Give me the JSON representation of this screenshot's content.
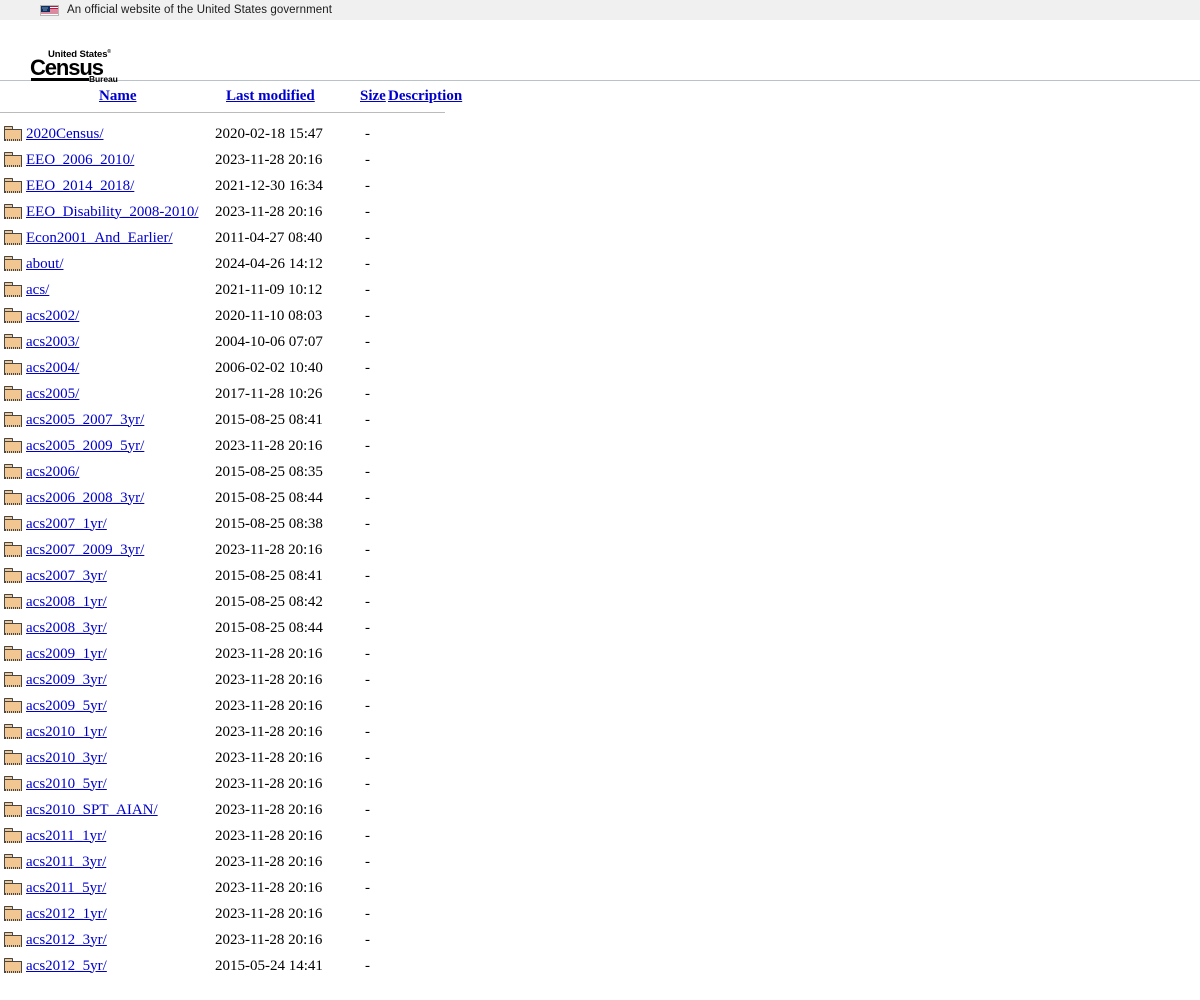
{
  "banner": {
    "text": "An official website of the United States government",
    "flag_icon": "us-flag-icon",
    "background": "#f0f0f0"
  },
  "site_header": {
    "logo": {
      "line1": "United States",
      "registered_mark": "®",
      "line2": "Census",
      "line3": "Bureau"
    }
  },
  "listing": {
    "columns": [
      {
        "key": "name",
        "label": "Name"
      },
      {
        "key": "last_modified",
        "label": "Last modified"
      },
      {
        "key": "size",
        "label": "Size"
      },
      {
        "key": "description",
        "label": "Description"
      }
    ],
    "link_color": "#0000cc",
    "icon": "folder-icon",
    "rows": [
      {
        "name": "2020Census/",
        "last_modified": "2020-02-18 15:47",
        "size": "-",
        "description": ""
      },
      {
        "name": "EEO_2006_2010/",
        "last_modified": "2023-11-28 20:16",
        "size": "-",
        "description": ""
      },
      {
        "name": "EEO_2014_2018/",
        "last_modified": "2021-12-30 16:34",
        "size": "-",
        "description": ""
      },
      {
        "name": "EEO_Disability_2008-2010/",
        "last_modified": "2023-11-28 20:16",
        "size": "-",
        "description": ""
      },
      {
        "name": "Econ2001_And_Earlier/",
        "last_modified": "2011-04-27 08:40",
        "size": "-",
        "description": ""
      },
      {
        "name": "about/",
        "last_modified": "2024-04-26 14:12",
        "size": "-",
        "description": ""
      },
      {
        "name": "acs/",
        "last_modified": "2021-11-09 10:12",
        "size": "-",
        "description": ""
      },
      {
        "name": "acs2002/",
        "last_modified": "2020-11-10 08:03",
        "size": "-",
        "description": ""
      },
      {
        "name": "acs2003/",
        "last_modified": "2004-10-06 07:07",
        "size": "-",
        "description": ""
      },
      {
        "name": "acs2004/",
        "last_modified": "2006-02-02 10:40",
        "size": "-",
        "description": ""
      },
      {
        "name": "acs2005/",
        "last_modified": "2017-11-28 10:26",
        "size": "-",
        "description": ""
      },
      {
        "name": "acs2005_2007_3yr/",
        "last_modified": "2015-08-25 08:41",
        "size": "-",
        "description": ""
      },
      {
        "name": "acs2005_2009_5yr/",
        "last_modified": "2023-11-28 20:16",
        "size": "-",
        "description": ""
      },
      {
        "name": "acs2006/",
        "last_modified": "2015-08-25 08:35",
        "size": "-",
        "description": ""
      },
      {
        "name": "acs2006_2008_3yr/",
        "last_modified": "2015-08-25 08:44",
        "size": "-",
        "description": ""
      },
      {
        "name": "acs2007_1yr/",
        "last_modified": "2015-08-25 08:38",
        "size": "-",
        "description": ""
      },
      {
        "name": "acs2007_2009_3yr/",
        "last_modified": "2023-11-28 20:16",
        "size": "-",
        "description": ""
      },
      {
        "name": "acs2007_3yr/",
        "last_modified": "2015-08-25 08:41",
        "size": "-",
        "description": ""
      },
      {
        "name": "acs2008_1yr/",
        "last_modified": "2015-08-25 08:42",
        "size": "-",
        "description": ""
      },
      {
        "name": "acs2008_3yr/",
        "last_modified": "2015-08-25 08:44",
        "size": "-",
        "description": ""
      },
      {
        "name": "acs2009_1yr/",
        "last_modified": "2023-11-28 20:16",
        "size": "-",
        "description": ""
      },
      {
        "name": "acs2009_3yr/",
        "last_modified": "2023-11-28 20:16",
        "size": "-",
        "description": ""
      },
      {
        "name": "acs2009_5yr/",
        "last_modified": "2023-11-28 20:16",
        "size": "-",
        "description": ""
      },
      {
        "name": "acs2010_1yr/",
        "last_modified": "2023-11-28 20:16",
        "size": "-",
        "description": ""
      },
      {
        "name": "acs2010_3yr/",
        "last_modified": "2023-11-28 20:16",
        "size": "-",
        "description": ""
      },
      {
        "name": "acs2010_5yr/",
        "last_modified": "2023-11-28 20:16",
        "size": "-",
        "description": ""
      },
      {
        "name": "acs2010_SPT_AIAN/",
        "last_modified": "2023-11-28 20:16",
        "size": "-",
        "description": ""
      },
      {
        "name": "acs2011_1yr/",
        "last_modified": "2023-11-28 20:16",
        "size": "-",
        "description": ""
      },
      {
        "name": "acs2011_3yr/",
        "last_modified": "2023-11-28 20:16",
        "size": "-",
        "description": ""
      },
      {
        "name": "acs2011_5yr/",
        "last_modified": "2023-11-28 20:16",
        "size": "-",
        "description": ""
      },
      {
        "name": "acs2012_1yr/",
        "last_modified": "2023-11-28 20:16",
        "size": "-",
        "description": ""
      },
      {
        "name": "acs2012_3yr/",
        "last_modified": "2023-11-28 20:16",
        "size": "-",
        "description": ""
      },
      {
        "name": "acs2012_5yr/",
        "last_modified": "2015-05-24 14:41",
        "size": "-",
        "description": ""
      }
    ]
  }
}
